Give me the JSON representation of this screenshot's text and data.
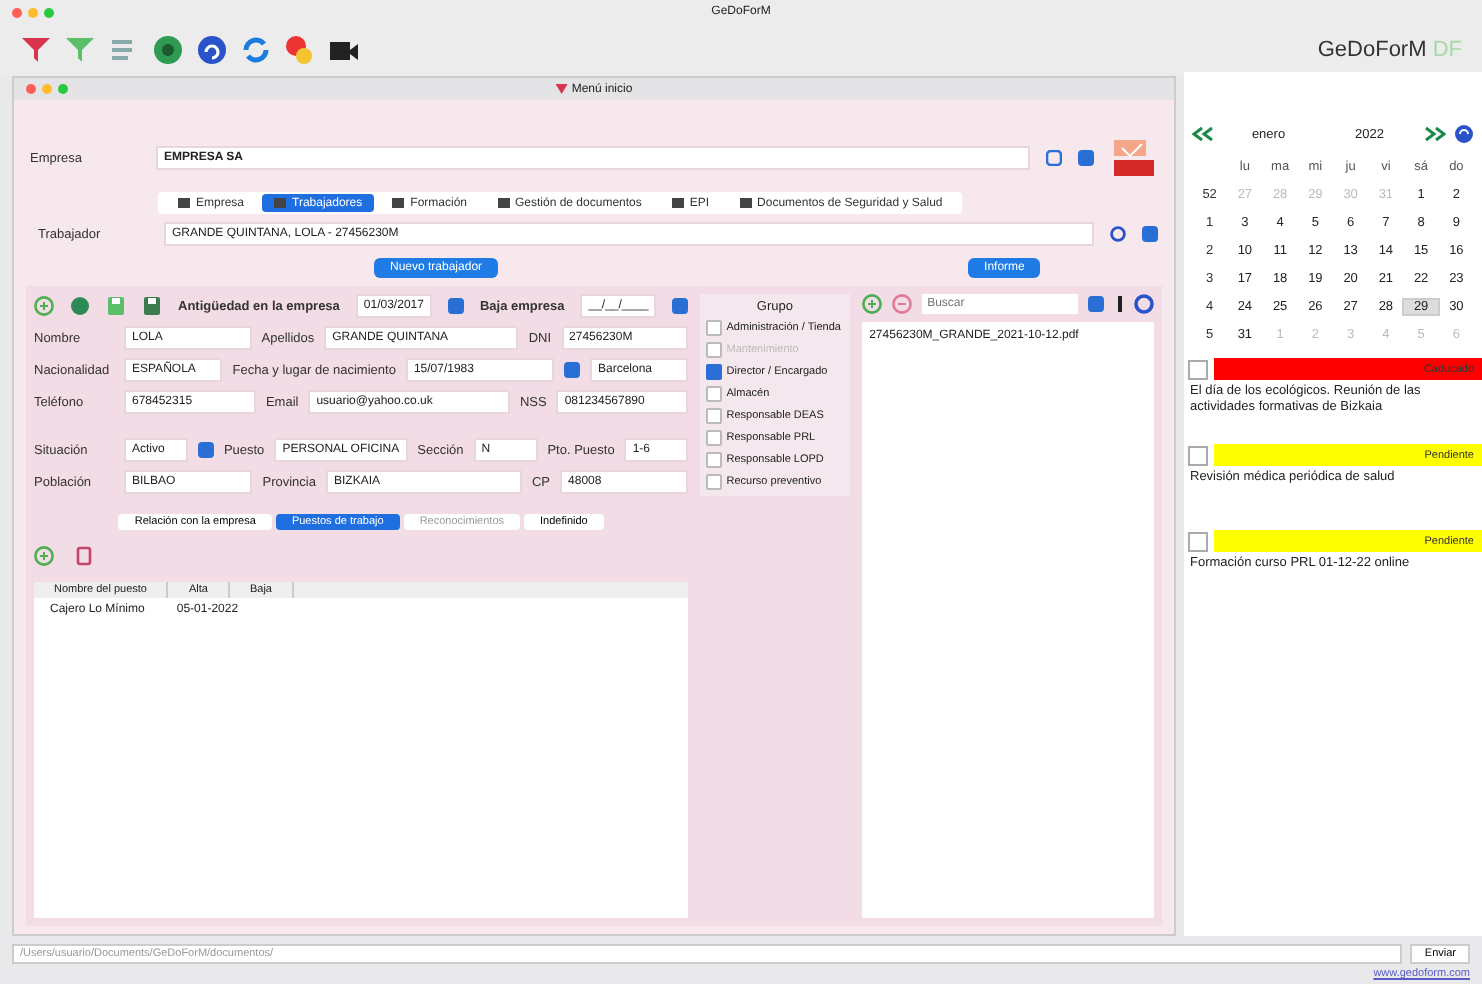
{
  "window": {
    "title": "GeDoForM"
  },
  "toolbar": {
    "brand": "GeDoForM",
    "brand_suffix": "DF"
  },
  "inner_window": {
    "title": "Menú inicio"
  },
  "empresa": {
    "label": "Empresa",
    "value": "EMPRESA SA"
  },
  "tabs": [
    {
      "label": "Empresa",
      "selected": false
    },
    {
      "label": "Trabajadores",
      "selected": true
    },
    {
      "label": "Formación",
      "selected": false
    },
    {
      "label": "Gestión de documentos",
      "selected": false
    },
    {
      "label": "EPI",
      "selected": false
    },
    {
      "label": "Documentos de Seguridad y Salud",
      "selected": false
    }
  ],
  "trabajador": {
    "label": "Trabajador",
    "value": "GRANDE QUINTANA, LOLA - 27456230M"
  },
  "buttons": {
    "new_worker": "Nuevo trabajador",
    "report": "Informe"
  },
  "antiguedad": {
    "label": "Antigüedad en la empresa",
    "value": "01/03/2017"
  },
  "baja": {
    "label": "Baja empresa",
    "value": "__/__/____"
  },
  "grupo": {
    "title": "Grupo",
    "items": [
      {
        "label": "Administración / Tienda",
        "checked": false,
        "disabled": false
      },
      {
        "label": "Mantenimiento",
        "checked": false,
        "disabled": true
      },
      {
        "label": "Director / Encargado",
        "checked": true,
        "disabled": false
      },
      {
        "label": "Almacén",
        "checked": false,
        "disabled": false
      },
      {
        "label": "Responsable DEAS",
        "checked": false,
        "disabled": false
      },
      {
        "label": "Responsable PRL",
        "checked": false,
        "disabled": false
      },
      {
        "label": "Responsable LOPD",
        "checked": false,
        "disabled": false
      },
      {
        "label": "Recurso preventivo",
        "checked": false,
        "disabled": false
      }
    ]
  },
  "field_rows": [
    [
      {
        "label": "Nombre",
        "value": "LOLA"
      },
      {
        "label": "Apellidos",
        "value": "GRANDE QUINTANA"
      },
      {
        "label": "DNI",
        "value": "27456230M"
      }
    ],
    [
      {
        "label": "Nacionalidad",
        "value": "ESPAÑOLA"
      },
      {
        "label": "Fecha y lugar de nacimiento",
        "value": "15/07/1983"
      },
      {
        "value": "Barcelona"
      }
    ],
    [
      {
        "label": "Teléfono",
        "value": "678452315"
      },
      {
        "label": "Email",
        "value": "usuario@yahoo.co.uk"
      },
      {
        "label": "NSS",
        "value": "081234567890"
      }
    ],
    [
      {
        "label": "Situación",
        "value": "Activo"
      },
      {
        "label": "Puesto",
        "value": "PERSONAL OFICINA"
      },
      {
        "label": "Sección",
        "value": "N"
      },
      {
        "label": "Pto. Puesto",
        "value": "1-6"
      }
    ],
    [
      {
        "label": "Población",
        "value": "BILBAO"
      },
      {
        "label": "Provincia",
        "value": "BIZKAIA"
      },
      {
        "label": "CP",
        "value": "48008"
      }
    ]
  ],
  "subtabs": [
    {
      "label": "Relación con la empresa",
      "selected": false,
      "disabled": false
    },
    {
      "label": "Puestos de trabajo",
      "selected": true,
      "disabled": false
    },
    {
      "label": "Reconocimientos",
      "selected": false,
      "disabled": true
    },
    {
      "label": "Indefinido",
      "selected": false,
      "disabled": false
    }
  ],
  "table": {
    "columns": [
      "Nombre del puesto",
      "Alta",
      "Baja"
    ],
    "rows": [
      {
        "cells": [
          "Cajero Lo Mínimo",
          "05-01-2022"
        ]
      }
    ]
  },
  "documents": {
    "search_placeholder": "Buscar",
    "items": [
      "27456230M_GRANDE_2021-10-12.pdf"
    ]
  },
  "calendar": {
    "month": "enero",
    "year": "2022",
    "weekdays": [
      "lu",
      "ma",
      "mi",
      "ju",
      "vi",
      "sá",
      "do"
    ],
    "weeks": [
      {
        "number": "52",
        "days": [
          {
            "day": "27",
            "other_month": true,
            "selected": false
          },
          {
            "day": "28",
            "other_month": true,
            "selected": false
          },
          {
            "day": "29",
            "other_month": true,
            "selected": false
          },
          {
            "day": "30",
            "other_month": true,
            "selected": false
          },
          {
            "day": "31",
            "other_month": true,
            "selected": false
          },
          {
            "day": "1",
            "other_month": false,
            "selected": false
          },
          {
            "day": "2",
            "other_month": false,
            "selected": false
          }
        ]
      },
      {
        "number": "1",
        "days": [
          {
            "day": "3",
            "other_month": false,
            "selected": false
          },
          {
            "day": "4",
            "other_month": false,
            "selected": false
          },
          {
            "day": "5",
            "other_month": false,
            "selected": false
          },
          {
            "day": "6",
            "other_month": false,
            "selected": false
          },
          {
            "day": "7",
            "other_month": false,
            "selected": false
          },
          {
            "day": "8",
            "other_month": false,
            "selected": false
          },
          {
            "day": "9",
            "other_month": false,
            "selected": false
          }
        ]
      },
      {
        "number": "2",
        "days": [
          {
            "day": "10",
            "other_month": false,
            "selected": false
          },
          {
            "day": "11",
            "other_month": false,
            "selected": false
          },
          {
            "day": "12",
            "other_month": false,
            "selected": false
          },
          {
            "day": "13",
            "other_month": false,
            "selected": false
          },
          {
            "day": "14",
            "other_month": false,
            "selected": false
          },
          {
            "day": "15",
            "other_month": false,
            "selected": false
          },
          {
            "day": "16",
            "other_month": false,
            "selected": false
          }
        ]
      },
      {
        "number": "3",
        "days": [
          {
            "day": "17",
            "other_month": false,
            "selected": false
          },
          {
            "day": "18",
            "other_month": false,
            "selected": false
          },
          {
            "day": "19",
            "other_month": false,
            "selected": false
          },
          {
            "day": "20",
            "other_month": false,
            "selected": false
          },
          {
            "day": "21",
            "other_month": false,
            "selected": false
          },
          {
            "day": "22",
            "other_month": false,
            "selected": false
          },
          {
            "day": "23",
            "other_month": false,
            "selected": false
          }
        ]
      },
      {
        "number": "4",
        "days": [
          {
            "day": "24",
            "other_month": false,
            "selected": false
          },
          {
            "day": "25",
            "other_month": false,
            "selected": false
          },
          {
            "day": "26",
            "other_month": false,
            "selected": false
          },
          {
            "day": "27",
            "other_month": false,
            "selected": false
          },
          {
            "day": "28",
            "other_month": false,
            "selected": false
          },
          {
            "day": "29",
            "other_month": false,
            "selected": true
          },
          {
            "day": "30",
            "other_month": false,
            "selected": false
          }
        ]
      },
      {
        "number": "5",
        "days": [
          {
            "day": "31",
            "other_month": false,
            "selected": false
          },
          {
            "day": "1",
            "other_month": true,
            "selected": false
          },
          {
            "day": "2",
            "other_month": true,
            "selected": false
          },
          {
            "day": "3",
            "other_month": true,
            "selected": false
          },
          {
            "day": "4",
            "other_month": true,
            "selected": false
          },
          {
            "day": "5",
            "other_month": true,
            "selected": false
          },
          {
            "day": "6",
            "other_month": true,
            "selected": false
          }
        ]
      }
    ]
  },
  "events": [
    {
      "status": "Caducado",
      "color": "#ff0000",
      "checked": false,
      "text": "El día de los ecológicos. Reunión de las actividades formativas de Bizkaia"
    },
    {
      "status": "Pendiente",
      "color": "#ffff00",
      "checked": false,
      "text": "Revisión médica periódica de salud"
    },
    {
      "status": "Pendiente",
      "color": "#ffff00",
      "checked": false,
      "text": "Formación curso PRL 01-12-22 online"
    }
  ],
  "bottom": {
    "path": "/Users/usuario/Documents/GeDoForM/documentos/",
    "send": "Enviar",
    "link": "www.gedoform.com"
  }
}
